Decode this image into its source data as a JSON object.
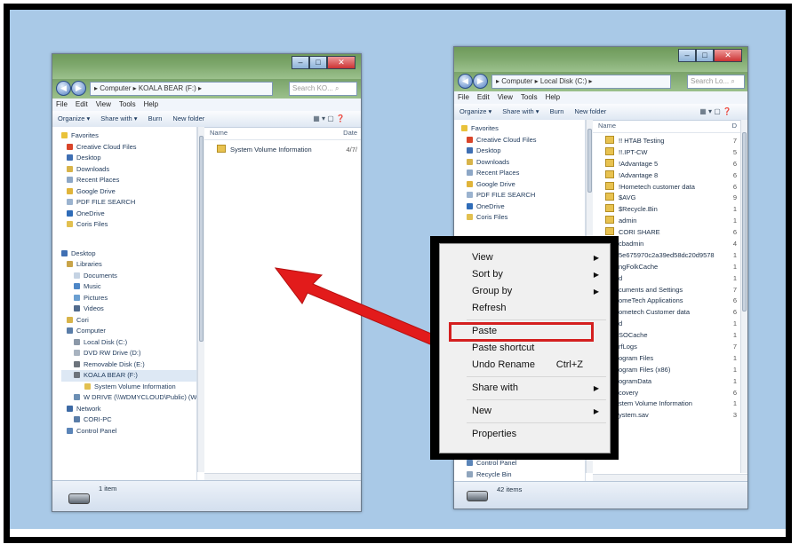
{
  "left_window": {
    "address": [
      "Computer",
      "KOALA BEAR (F:)"
    ],
    "search_placeholder": "Search KO...",
    "menu": [
      "File",
      "Edit",
      "View",
      "Tools",
      "Help"
    ],
    "toolbar": [
      "Organize ▾",
      "Share with ▾",
      "Burn",
      "New folder"
    ],
    "nav": [
      "Favorites",
      "Creative Cloud Files",
      "Desktop",
      "Downloads",
      "Recent Places",
      "Google Drive",
      "PDF FILE SEARCH",
      "OneDrive",
      "Coris Files",
      "",
      "Desktop",
      "Libraries",
      "Documents",
      "Music",
      "Pictures",
      "Videos",
      "Cori",
      "Computer",
      "Local Disk (C:)",
      "DVD RW Drive (D:)",
      "Removable Disk (E:)",
      "KOALA BEAR (F:)",
      "System Volume Information",
      "W DRIVE (\\\\WDMYCLOUD\\Public) (W:)",
      "Network",
      "CORI-PC",
      "Control Panel"
    ],
    "columns": [
      "Name",
      "Date"
    ],
    "files": [
      {
        "name": "System Volume Information",
        "date": "4/7/"
      }
    ],
    "status": "1 item"
  },
  "right_window": {
    "address": [
      "Computer",
      "Local Disk (C:)"
    ],
    "search_placeholder": "Search Lo...",
    "menu": [
      "File",
      "Edit",
      "View",
      "Tools",
      "Help"
    ],
    "toolbar": [
      "Organize ▾",
      "Share with ▾",
      "Burn",
      "New folder"
    ],
    "nav": [
      "Favorites",
      "Creative Cloud Files",
      "Desktop",
      "Downloads",
      "Recent Places",
      "Google Drive",
      "PDF FILE SEARCH",
      "OneDrive",
      "Coris Files"
    ],
    "columns": [
      "Name",
      "D"
    ],
    "files": [
      {
        "name": "!! HTAB Testing",
        "date": "7"
      },
      {
        "name": "!!.IPT-CW",
        "date": "5"
      },
      {
        "name": "!Advantage 5",
        "date": "6"
      },
      {
        "name": "!Advantage 8",
        "date": "6"
      },
      {
        "name": "!Hometech customer data",
        "date": "6"
      },
      {
        "name": "$AVG",
        "date": "9"
      },
      {
        "name": "$Recycle.Bin",
        "date": "1"
      },
      {
        "name": "admin",
        "date": "1"
      },
      {
        "name": "CORI SHARE",
        "date": "6"
      },
      {
        "name": "cbadmin",
        "date": "4"
      },
      {
        "name": "5e675970c2a39ed58dc20d9578",
        "date": "1"
      },
      {
        "name": "ngFolkCache",
        "date": "1"
      },
      {
        "name": "d",
        "date": "1"
      },
      {
        "name": "cuments and Settings",
        "date": "7"
      },
      {
        "name": "omeTech Applications",
        "date": "6"
      },
      {
        "name": "ometech Customer data",
        "date": "6"
      },
      {
        "name": "d",
        "date": "1"
      },
      {
        "name": "SOCache",
        "date": "1"
      },
      {
        "name": "rfLogs",
        "date": "7"
      },
      {
        "name": "ogram Files",
        "date": "1"
      },
      {
        "name": "ogram Files (x86)",
        "date": "1"
      },
      {
        "name": "ogramData",
        "date": "1"
      },
      {
        "name": "covery",
        "date": "6"
      },
      {
        "name": "stem Volume Information",
        "date": "1"
      },
      {
        "name": "ystem.sav",
        "date": "3"
      }
    ],
    "nav_bottom": [
      "Control Panel",
      "Recycle Bin"
    ],
    "status": "42 items"
  },
  "context_menu": {
    "items": [
      {
        "label": "View",
        "submenu": true
      },
      {
        "label": "Sort by",
        "submenu": true
      },
      {
        "label": "Group by",
        "submenu": true
      },
      {
        "label": "Refresh"
      },
      {
        "label": "Paste"
      },
      {
        "label": "Paste shortcut"
      },
      {
        "label": "Undo Rename",
        "shortcut": "Ctrl+Z"
      },
      {
        "label": "Share with",
        "submenu": true
      },
      {
        "label": "New",
        "submenu": true
      },
      {
        "label": "Properties"
      }
    ],
    "highlighted": "Paste"
  },
  "colors": {
    "background": "#a9c9e7",
    "highlight": "#d42020",
    "arrow": "#e21b1b",
    "title_glass": "#7ea86d"
  }
}
